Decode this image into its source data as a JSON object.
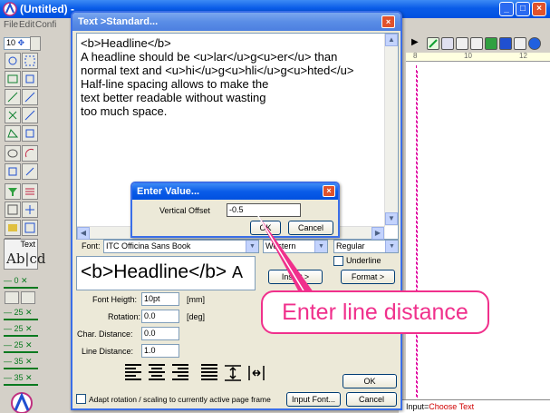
{
  "main_window": {
    "title": "(Untitled) -",
    "menu": [
      "File",
      "Edit",
      "Confi"
    ]
  },
  "left_palette": {
    "zoom_value": "10",
    "text_tool_label": "Text",
    "text_tool_sample": "Ab|cd",
    "line_widths": [
      "0",
      "25",
      "25",
      "25",
      "35",
      "35"
    ]
  },
  "ruler": {
    "ticks": [
      "8",
      "10",
      "12"
    ]
  },
  "text_dialog": {
    "title": "Text >Standard...",
    "editor_lines": [
      "<b>Headline</b>",
      "A headline should be <u>lar</u>g<u>er</u> than",
      "normal text and <u>hi</u>g<u>hli</u>g<u>hted</u>",
      "Half-line spacing allows to make the",
      "text better readable without wasting",
      "too much space."
    ],
    "font_label": "Font:",
    "font_value": "ITC Officina Sans Book",
    "script_value": "Western",
    "style_value": "Regular",
    "underline_label": "Underline",
    "preview_text": "<b>Headline</b>",
    "insert_button": "Insert >",
    "format_button": "Format >",
    "font_height_label": "Font Heigth:",
    "font_height_value": "10pt",
    "font_height_unit": "[mm]",
    "rotation_label": "Rotation:",
    "rotation_value": "0.0",
    "rotation_unit": "[deg]",
    "char_distance_label": "Char. Distance:",
    "char_distance_value": "0.0",
    "line_distance_label": "Line Distance:",
    "line_distance_value": "1.0",
    "ok_button": "OK",
    "cancel_button": "Cancel",
    "adapt_label": "Adapt rotation / scaling to currently active page frame",
    "input_font_button": "Input Font..."
  },
  "value_dialog": {
    "title": "Enter Value...",
    "field_label": "Vertical Offset",
    "field_value": "-0.5",
    "ok_button": "OK",
    "cancel_button": "Cancel"
  },
  "callout": {
    "text": "Enter line distance"
  },
  "status_bar": {
    "label": "Input=",
    "value": "Choose Text"
  },
  "colors": {
    "accent": "#0a5ce8",
    "callout": "#f0308c",
    "status_value": "#d00000"
  }
}
